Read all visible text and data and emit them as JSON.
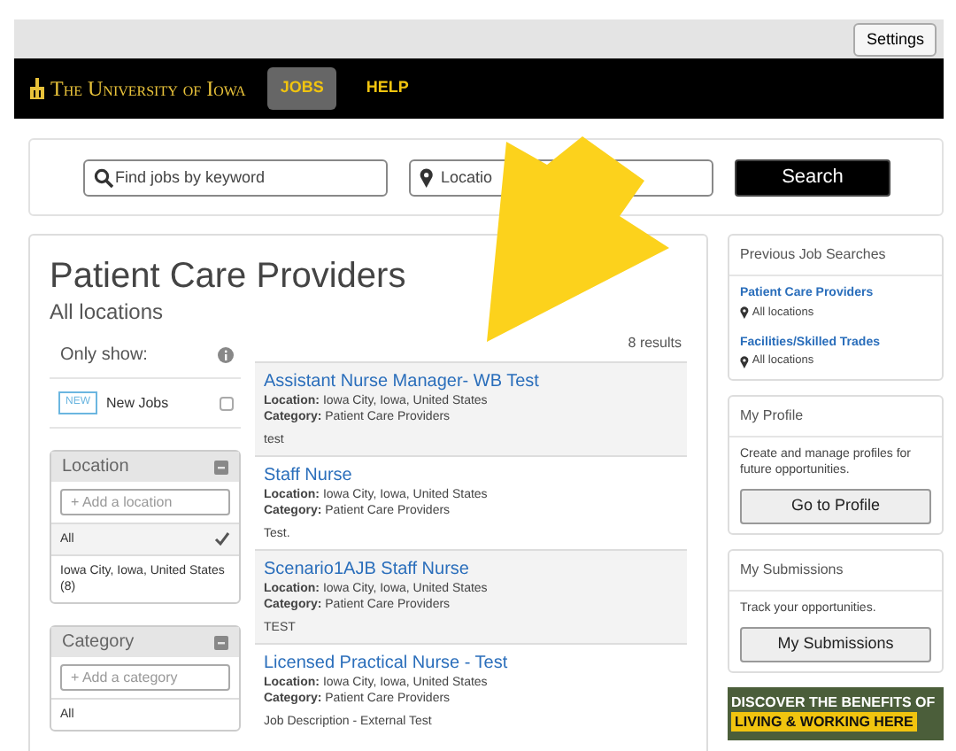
{
  "top_bar": {
    "settings_button": "Settings"
  },
  "nav": {
    "logo": "The University of Iowa",
    "items": [
      {
        "label": "JOBS",
        "selected": true
      },
      {
        "label": "HELP",
        "selected": false
      }
    ]
  },
  "search": {
    "keyword_placeholder": "Find jobs by keyword",
    "location_placeholder": "Locatio",
    "button": "Search"
  },
  "results_panel": {
    "title": "Patient Care Providers",
    "subtitle": "All locations",
    "only_show": {
      "label": "Only show:",
      "badge": "NEW",
      "option": "New Jobs",
      "checked": false
    },
    "facets": [
      {
        "title": "Location",
        "add_placeholder": "+ Add a location",
        "options": [
          {
            "label": "All",
            "selected": true
          },
          {
            "label": "Iowa City, Iowa, United States (8)",
            "selected": false
          }
        ]
      },
      {
        "title": "Category",
        "add_placeholder": "+ Add a category",
        "options": [
          {
            "label": "All",
            "selected": false
          }
        ]
      }
    ],
    "results_count": "8 results",
    "jobs": [
      {
        "title": "Assistant Nurse Manager- WB Test",
        "location": "**Location:** Iowa City, Iowa, United States",
        "category": "**Category:** Patient Care Providers",
        "description": "test"
      },
      {
        "title": "Staff Nurse",
        "location": "**Location:** Iowa City, Iowa, United States",
        "category": "**Category:** Patient Care Providers",
        "description": "Test."
      },
      {
        "title": "Scenario1AJB Staff Nurse",
        "location": "**Location:** Iowa City, Iowa, United States",
        "category": "**Category:** Patient Care Providers",
        "description": "TEST"
      },
      {
        "title": "Licensed Practical Nurse - Test",
        "location": "**Location:** Iowa City, Iowa, United States",
        "category": "**Category:** Patient Care Providers",
        "description": "Job Description - External Test"
      }
    ]
  },
  "sidebar": {
    "previous_searches": {
      "title": "Previous Job Searches",
      "items": [
        {
          "title": "Patient Care Providers",
          "location": "All locations"
        },
        {
          "title": "Facilities/Skilled Trades",
          "location": "All locations"
        }
      ]
    },
    "profile": {
      "title": "My Profile",
      "text": "Create and manage profiles for future opportunities.",
      "button": "Go to Profile"
    },
    "submissions": {
      "title": "My Submissions",
      "text": "Track your opportunities.",
      "button": "My Submissions"
    },
    "banner": {
      "line_1": "DISCOVER THE BENEFITS OF",
      "line_2": "LIVING & WORKING HERE"
    }
  }
}
